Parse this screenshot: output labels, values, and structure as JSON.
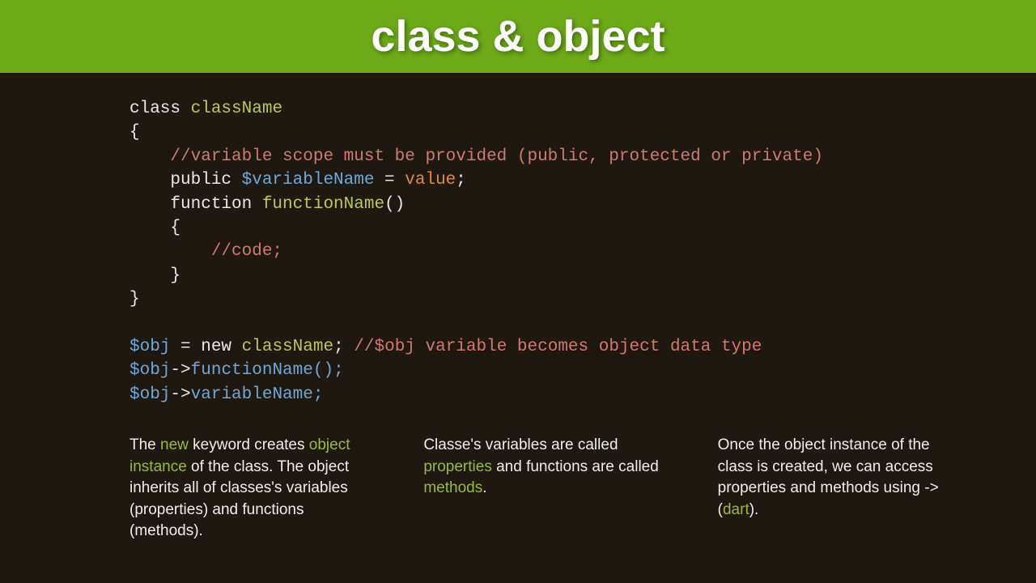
{
  "header": {
    "title": "class & object"
  },
  "code": {
    "l1_kw": "class ",
    "l1_name": "className",
    "l2": "{",
    "l3_comment": "    //variable scope must be provided (public, protected or private)",
    "l4_pub": "    public ",
    "l4_var": "$variableName",
    "l4_eq": " = ",
    "l4_val": "value",
    "l4_semi": ";",
    "l5_fn": "    function ",
    "l5_name": "functionName",
    "l5_par": "()",
    "l6": "    {",
    "l7_comment": "        //code;",
    "l8": "    }",
    "l9": "}",
    "l11_obj": "$obj",
    "l11_eq": " = new ",
    "l11_cls": "className",
    "l11_semi": "; ",
    "l11_comment": "//$obj variable becomes object data type",
    "l12_obj": "$obj",
    "l12_arrow": "->",
    "l12_call": "functionName();",
    "l13_obj": "$obj",
    "l13_arrow": "->",
    "l13_call": "variableName;"
  },
  "cols": {
    "c1_a": "The ",
    "c1_b": "new",
    "c1_c": " keyword creates ",
    "c1_d": "object instance",
    "c1_e": " of the class. The object inherits all of classes's variables (properties) and functions (methods).",
    "c2_a": "Classe's variables are called ",
    "c2_b": "properties",
    "c2_c": " and functions are called ",
    "c2_d": "methods",
    "c2_e": ".",
    "c3_a": "Once the object instance of the class is created, we can access properties and methods using -> (",
    "c3_b": "dart",
    "c3_c": ")."
  }
}
